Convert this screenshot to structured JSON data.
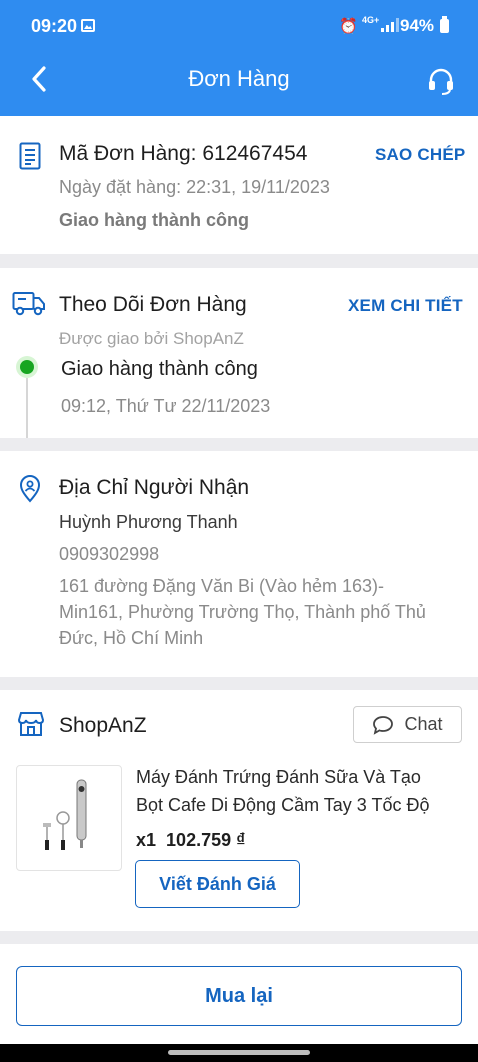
{
  "status_bar": {
    "time": "09:20",
    "network": "4G+",
    "battery": "94%"
  },
  "header": {
    "title": "Đơn Hàng"
  },
  "order": {
    "code_label": "Mã Đơn Hàng: 612467454",
    "copy_action": "SAO CHÉP",
    "order_date": "Ngày đặt hàng: 22:31, 19/11/2023",
    "status": "Giao hàng thành công"
  },
  "tracking": {
    "title": "Theo Dõi Đơn Hàng",
    "detail_action": "XEM CHI TIẾT",
    "carrier": "Được giao bởi ShopAnZ",
    "event_status": "Giao hàng thành công",
    "event_time": "09:12, Thứ Tư 22/11/2023"
  },
  "address": {
    "title": "Địa Chỉ Người Nhận",
    "name": "Huỳnh Phương Thanh",
    "phone": "0909302998",
    "line1": "161 đường Đặng Văn Bi (Vào hẻm 163)-",
    "line2": "Min161, Phường Trường Thọ, Thành phố Thủ",
    "line3": "Đức, Hồ Chí Minh"
  },
  "shop": {
    "name": "ShopAnZ",
    "chat_label": "Chat",
    "product": {
      "name_line1": "Máy Đánh Trứng Đánh Sữa Và Tạo",
      "name_line2": "Bọt Cafe Di Động Cầm Tay 3 Tốc Độ",
      "quantity": "x1",
      "price": "102.759 ₫"
    },
    "review_label": "Viết Đánh Giá"
  },
  "actions": {
    "rebuy_label": "Mua lại"
  },
  "colors": {
    "primary": "#2f8cf0",
    "link": "#1565c0",
    "success": "#17a521"
  }
}
